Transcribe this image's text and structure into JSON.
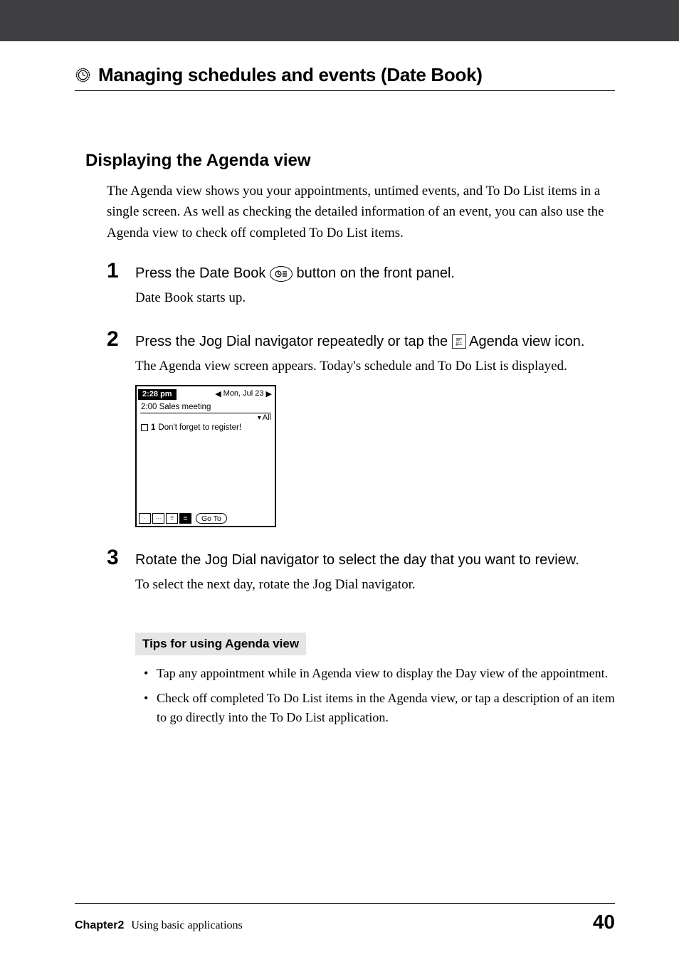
{
  "header": {
    "title": "Managing schedules and events (Date Book)"
  },
  "section": {
    "title": "Displaying the Agenda view",
    "intro": "The Agenda view shows you your appointments, untimed events, and To Do List items in a single screen. As well as checking the detailed information of an event, you can also use the Agenda view to check off completed To Do List items."
  },
  "steps": [
    {
      "num": "1",
      "instr_pre": "Press the Date Book ",
      "instr_post": " button on the front panel.",
      "body": "Date Book starts up."
    },
    {
      "num": "2",
      "instr_pre": "Press the Jog Dial navigator repeatedly or tap the ",
      "instr_post": " Agenda view icon.",
      "body": "The Agenda view screen appears. Today's schedule and To Do List is displayed."
    },
    {
      "num": "3",
      "instr_pre": "Rotate the Jog Dial navigator to select the day that you want to review.",
      "instr_post": "",
      "body": "To select the next day, rotate the Jog Dial navigator."
    }
  ],
  "figure": {
    "time": "2:28 pm",
    "date": "Mon, Jul 23",
    "appointment": "2:00 Sales meeting",
    "filter": "All",
    "todo_priority": "1",
    "todo_text": "Don't forget to register!",
    "goto": "Go To"
  },
  "tips": {
    "label": "Tips for using Agenda view",
    "items": [
      "Tap any appointment while in Agenda view to display the Day view of the appointment.",
      "Check off completed To Do List items in the Agenda view, or tap a description of an item to go directly into the To Do List application."
    ]
  },
  "footer": {
    "chapter": "Chapter2",
    "subtitle": "Using basic applications",
    "page": "40"
  }
}
